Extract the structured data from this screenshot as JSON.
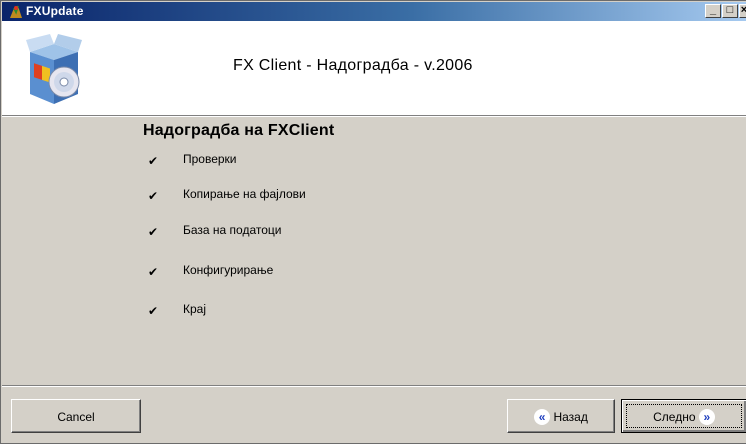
{
  "window": {
    "title": "FXUpdate",
    "controls": {
      "minimize": "_",
      "maximize": "□",
      "close": "×"
    }
  },
  "header": {
    "title": "FX Client - Надоградба - v.2006",
    "logo_icon": "setup-box-cd-icon"
  },
  "main": {
    "section_title": "Надоградба на FXClient",
    "steps": [
      {
        "label": "Проверки",
        "done": true
      },
      {
        "label": "Копирање на фајлови",
        "done": true
      },
      {
        "label": "База на податоци",
        "done": true
      },
      {
        "label": "Конфигурирање",
        "done": true
      },
      {
        "label": "Крај",
        "done": true
      }
    ],
    "check_glyph": "✔"
  },
  "footer": {
    "cancel_label": "Cancel",
    "back_label": "Назад",
    "next_label": "Следно",
    "back_icon": "«",
    "next_icon": "»"
  },
  "colors": {
    "titlebar_start": "#0a246a",
    "titlebar_end": "#a6caf0",
    "dialog_bg": "#d4d0c8",
    "arrow_blue": "#1f3fbf"
  }
}
